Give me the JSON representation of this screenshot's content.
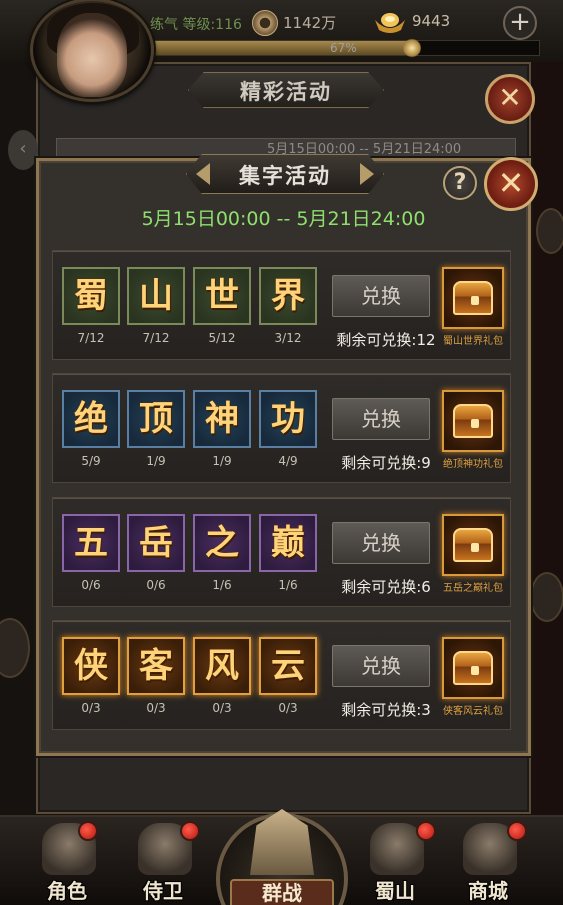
{
  "topbar": {
    "level_text": "练气 等级:116",
    "coins": "1142万",
    "gold": "9443",
    "plus_label": "+",
    "exp_percent_text": "67%",
    "exp_fraction": 0.67
  },
  "background_panel": {
    "title": "精彩活动",
    "date_strip": "5月15日00:00 -- 5月21日24:00",
    "close_label": "✕",
    "left_arrow": "‹"
  },
  "panel": {
    "title": "集字活动",
    "help_label": "?",
    "close_label": "✕",
    "date_range": "5月15日00:00 -- 5月21日24:00"
  },
  "exchange_label": "兑换",
  "rows": [
    {
      "theme": "green",
      "chars": [
        {
          "char": "蜀",
          "count": "7/12"
        },
        {
          "char": "山",
          "count": "7/12"
        },
        {
          "char": "世",
          "count": "5/12"
        },
        {
          "char": "界",
          "count": "3/12"
        }
      ],
      "remaining": "剩余可兑换:12",
      "gift_name": "蜀山世界礼包"
    },
    {
      "theme": "blue",
      "chars": [
        {
          "char": "绝",
          "count": "5/9"
        },
        {
          "char": "顶",
          "count": "1/9"
        },
        {
          "char": "神",
          "count": "1/9"
        },
        {
          "char": "功",
          "count": "4/9"
        }
      ],
      "remaining": "剩余可兑换:9",
      "gift_name": "绝顶神功礼包"
    },
    {
      "theme": "purple",
      "chars": [
        {
          "char": "五",
          "count": "0/6"
        },
        {
          "char": "岳",
          "count": "0/6"
        },
        {
          "char": "之",
          "count": "1/6"
        },
        {
          "char": "巅",
          "count": "1/6"
        }
      ],
      "remaining": "剩余可兑换:6",
      "gift_name": "五岳之巅礼包"
    },
    {
      "theme": "orange",
      "chars": [
        {
          "char": "侠",
          "count": "0/3"
        },
        {
          "char": "客",
          "count": "0/3"
        },
        {
          "char": "风",
          "count": "0/3"
        },
        {
          "char": "云",
          "count": "0/3"
        }
      ],
      "remaining": "剩余可兑换:3",
      "gift_name": "侠客风云礼包"
    }
  ],
  "nav": {
    "role": "角色",
    "guard": "侍卫",
    "battle": "群战",
    "shushan": "蜀山",
    "shop": "商城"
  },
  "colors": {
    "date_green": "#8ee06e",
    "gold_text": "#ffd37a",
    "close_red": "#b44a2f"
  }
}
